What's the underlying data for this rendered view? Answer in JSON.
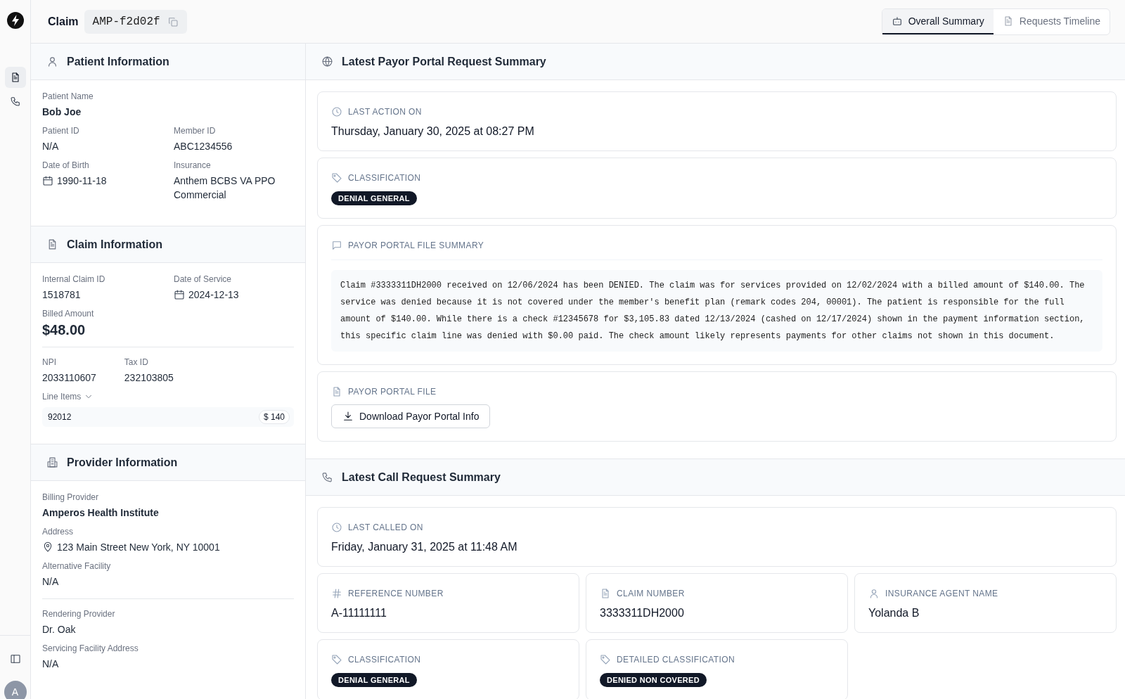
{
  "header": {
    "title": "Claim",
    "claim_id": "AMP-f2d02f"
  },
  "view_tabs": [
    {
      "label": "Overall Summary",
      "selected": true
    },
    {
      "label": "Requests Timeline",
      "selected": false
    }
  ],
  "rail": {
    "items": [
      {
        "selected": true
      },
      {
        "selected": false
      }
    ],
    "avatar": "A"
  },
  "left_sections": [
    {
      "title": "Patient Information",
      "groups": [
        [
          [
            {
              "label": "Patient Name",
              "value": "Bob Joe",
              "kind": "strong"
            }
          ],
          [
            {
              "label": "Patient ID",
              "value": "N/A",
              "kind": "plain"
            },
            {
              "label": "Member ID",
              "value": "ABC1234556",
              "kind": "plain"
            }
          ],
          [
            {
              "label": "Date of Birth",
              "value": "1990-11-18",
              "kind": "date"
            },
            {
              "label": "Insurance",
              "value": "Anthem BCBS VA PPO Commercial",
              "kind": "plain"
            }
          ]
        ]
      ]
    },
    {
      "title": "Claim Information",
      "groups": [
        [
          [
            {
              "label": "Internal Claim ID",
              "value": "1518781",
              "kind": "plain"
            },
            {
              "label": "Date of Service",
              "value": "2024-12-13",
              "kind": "date"
            }
          ],
          [
            {
              "label": "Billed Amount",
              "value": "$48.00",
              "kind": "amount"
            }
          ]
        ],
        [
          [
            {
              "label": "NPI",
              "value": "2033110607",
              "kind": "plain"
            },
            {
              "label": "Tax ID",
              "value": "232103805",
              "kind": "plain"
            }
          ]
        ]
      ],
      "line_items": {
        "label": "Line Items",
        "expanded": true,
        "items": [
          {
            "code": "92012",
            "amount": "$ 140"
          }
        ]
      }
    },
    {
      "title": "Provider Information",
      "groups": [
        [
          [
            {
              "label": "Billing Provider",
              "value": "Amperos Health Institute",
              "kind": "strong"
            }
          ],
          [
            {
              "label": "Address",
              "value": "123 Main Street New York, NY 10001",
              "kind": "address"
            }
          ],
          [
            {
              "label": "Alternative Facility",
              "value": "N/A",
              "kind": "plain"
            }
          ]
        ],
        [
          [
            {
              "label": "Rendering Provider",
              "value": "Dr. Oak",
              "kind": "plain"
            }
          ],
          [
            {
              "label": "Servicing Facility Address",
              "value": "N/A",
              "kind": "plain"
            }
          ]
        ]
      ]
    }
  ],
  "right_sections": [
    {
      "title": "Latest Payor Portal Request Summary",
      "rows": [
        [
          {
            "kind": "datetime",
            "label": "LAST ACTION ON",
            "value": "Thursday, January 30, 2025 at 08:27 PM"
          }
        ],
        [
          {
            "kind": "badge",
            "label": "CLASSIFICATION",
            "value": "DENIAL GENERAL"
          }
        ],
        [
          {
            "kind": "text",
            "label": "PAYOR PORTAL FILE SUMMARY",
            "value": "Claim #3333311DH2000 received on 12/06/2024 has been DENIED. The claim was for services provided on 12/02/2024 with a billed amount of $140.00. The service was denied because it is not covered under the member's benefit plan (remark codes 204, 00001). The patient is responsible for the full amount of $140.00. While there is a check #12345678 for $3,105.83 dated 12/13/2024 (cashed on 12/17/2024) shown in the payment information section, this specific claim line was denied with $0.00 paid. The check amount likely represents payments for other claims not shown in this document."
          }
        ],
        [
          {
            "kind": "download",
            "label": "PAYOR PORTAL FILE",
            "value": "Download Payor Portal Info"
          }
        ]
      ]
    },
    {
      "title": "Latest Call Request Summary",
      "rows": [
        [
          {
            "kind": "datetime",
            "label": "LAST CALLED ON",
            "value": "Friday, January 31, 2025 at 11:48 AM"
          }
        ],
        [
          {
            "kind": "value",
            "label": "REFERENCE NUMBER",
            "value": "A-11111111"
          },
          {
            "kind": "value",
            "label": "CLAIM NUMBER",
            "value": "3333311DH2000"
          },
          {
            "kind": "value",
            "label": "INSURANCE AGENT NAME",
            "value": "Yolanda B"
          }
        ],
        [
          {
            "kind": "badge",
            "label": "CLASSIFICATION",
            "value": "DENIAL GENERAL"
          },
          {
            "kind": "badge",
            "label": "DETAILED CLASSIFICATION",
            "value": "DENIED NON COVERED"
          }
        ]
      ]
    }
  ]
}
